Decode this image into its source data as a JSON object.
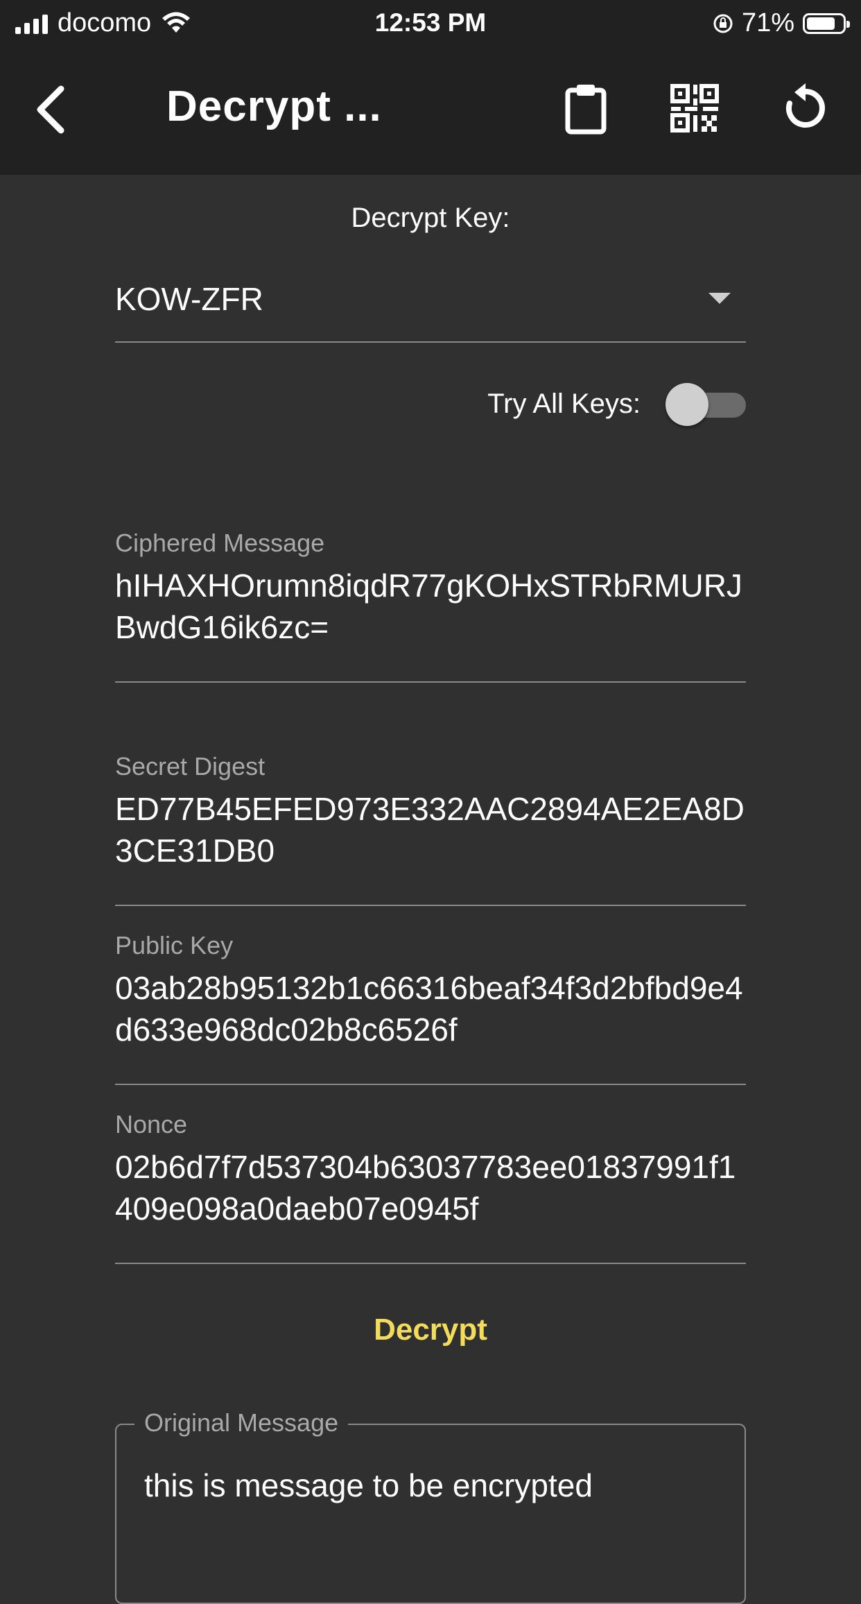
{
  "status_bar": {
    "carrier": "docomo",
    "time": "12:53 PM",
    "battery": "71%"
  },
  "app_bar": {
    "title": "Decrypt ...",
    "icons": [
      "back-arrow-icon",
      "clipboard-icon",
      "qr-code-icon",
      "refresh-icon"
    ]
  },
  "form": {
    "decrypt_key_label": "Decrypt Key:",
    "decrypt_key_value": "KOW-ZFR",
    "try_all_keys_label": "Try All Keys:",
    "try_all_keys_on": false,
    "ciphered_label": "Ciphered Message",
    "ciphered_value": "hIHAXHOrumn8iqdR77gKOHxSTRbRMURJBwdG16ik6zc=",
    "digest_label": "Secret Digest",
    "digest_value": "ED77B45EFED973E332AAC2894AE2EA8D3CE31DB0",
    "pubkey_label": "Public Key",
    "pubkey_value": "03ab28b95132b1c66316beaf34f3d2bfbd9e4d633e968dc02b8c6526f",
    "nonce_label": "Nonce",
    "nonce_value": "02b6d7f7d537304b63037783ee01837991f1409e098a0daeb07e0945f",
    "decrypt_button": "Decrypt",
    "original_label": "Original Message",
    "original_value": "this is message to be encrypted"
  },
  "colors": {
    "background": "#303030",
    "app_bar": "#212121",
    "accent": "#f3dc5b"
  }
}
